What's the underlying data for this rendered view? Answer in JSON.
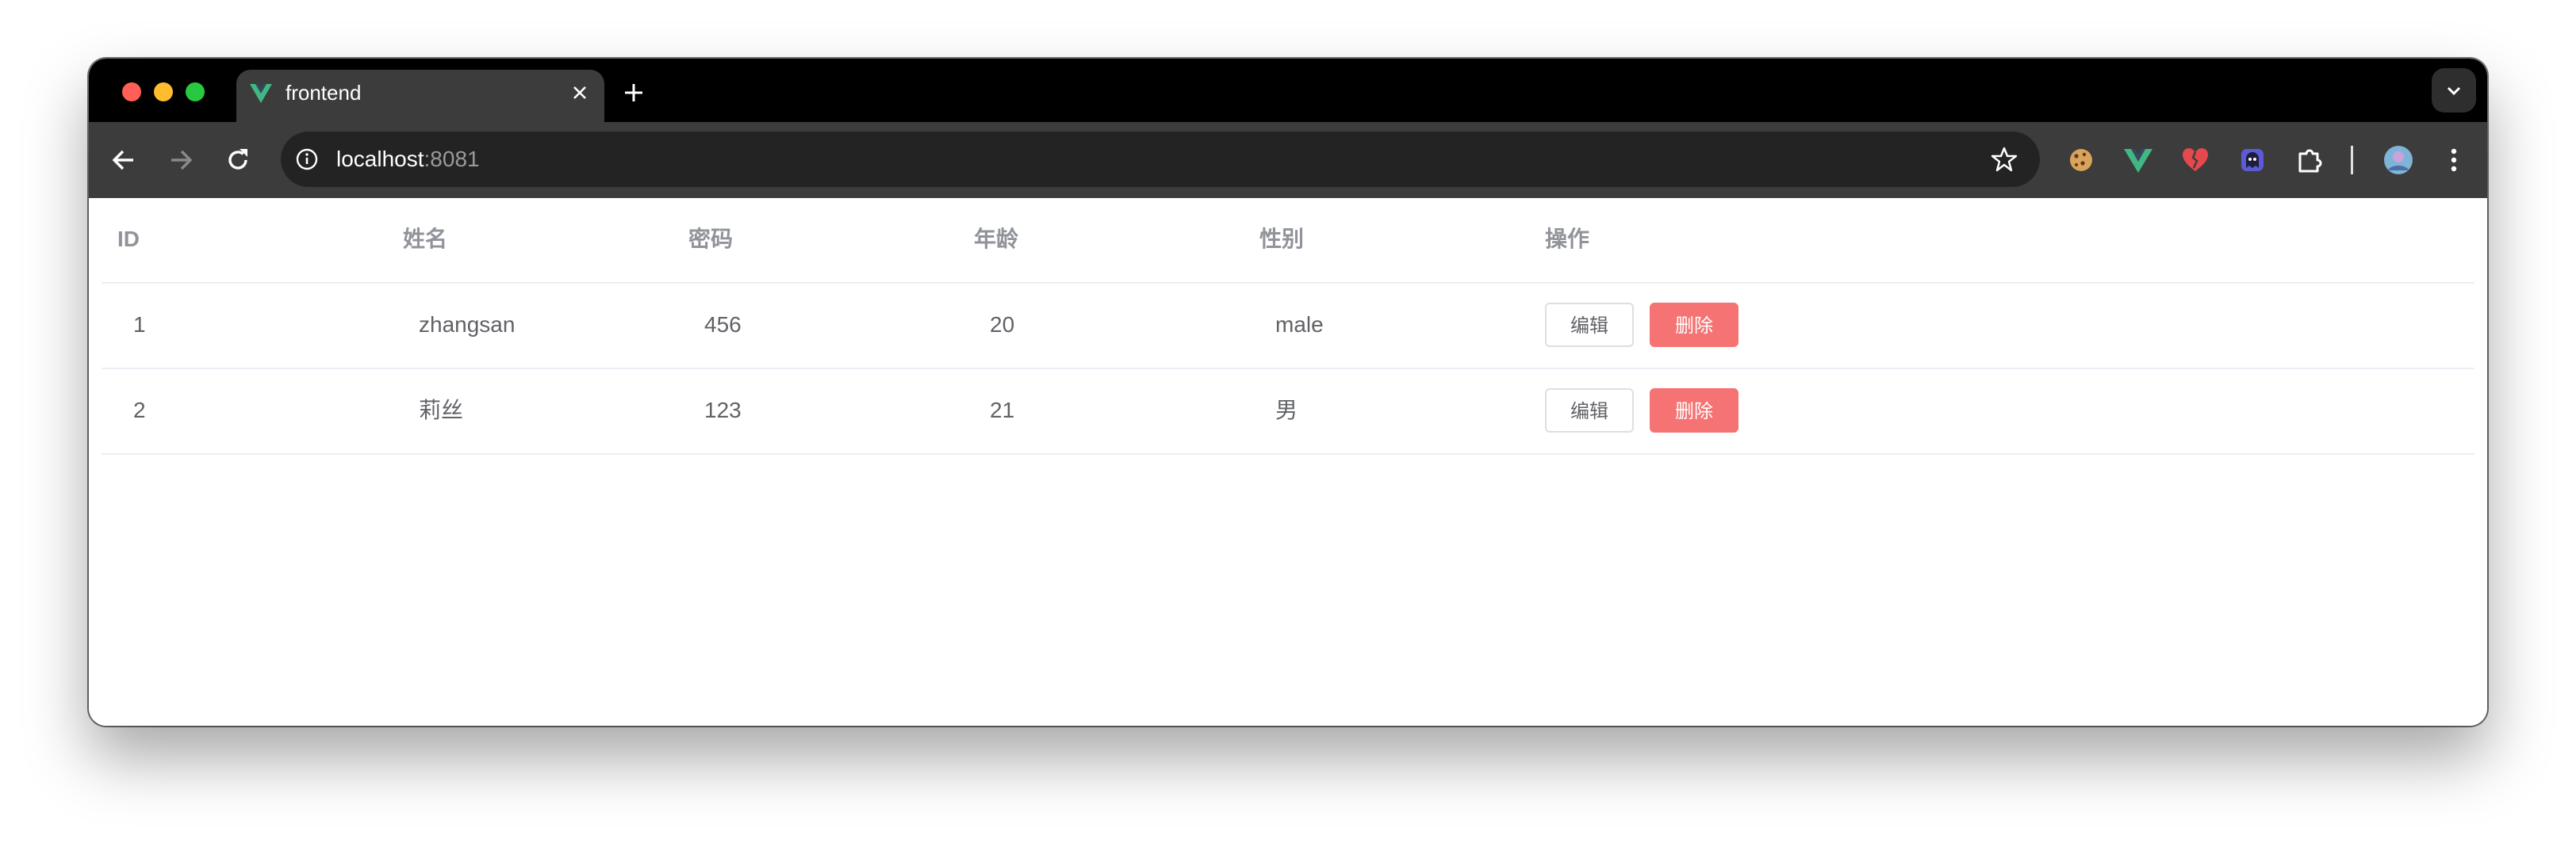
{
  "browser": {
    "tab_title": "frontend",
    "url_host": "localhost",
    "url_port": ":8081"
  },
  "table": {
    "headers": [
      "ID",
      "姓名",
      "密码",
      "年龄",
      "性别",
      "操作"
    ],
    "rows": [
      {
        "id": "1",
        "name": "zhangsan",
        "password": "456",
        "age": "20",
        "gender": "male"
      },
      {
        "id": "2",
        "name": "莉丝",
        "password": "123",
        "age": "21",
        "gender": "男"
      }
    ],
    "edit_label": "编辑",
    "delete_label": "删除"
  },
  "colors": {
    "vue_green": "#41b883",
    "danger": "#f56c6c"
  },
  "icons": {
    "tab_favicon": "vue-logo-icon",
    "extensions": [
      "cookie-icon",
      "vue-devtools-icon",
      "broken-heart-icon",
      "ghost-icon",
      "puzzle-icon"
    ],
    "profile": "avatar"
  }
}
